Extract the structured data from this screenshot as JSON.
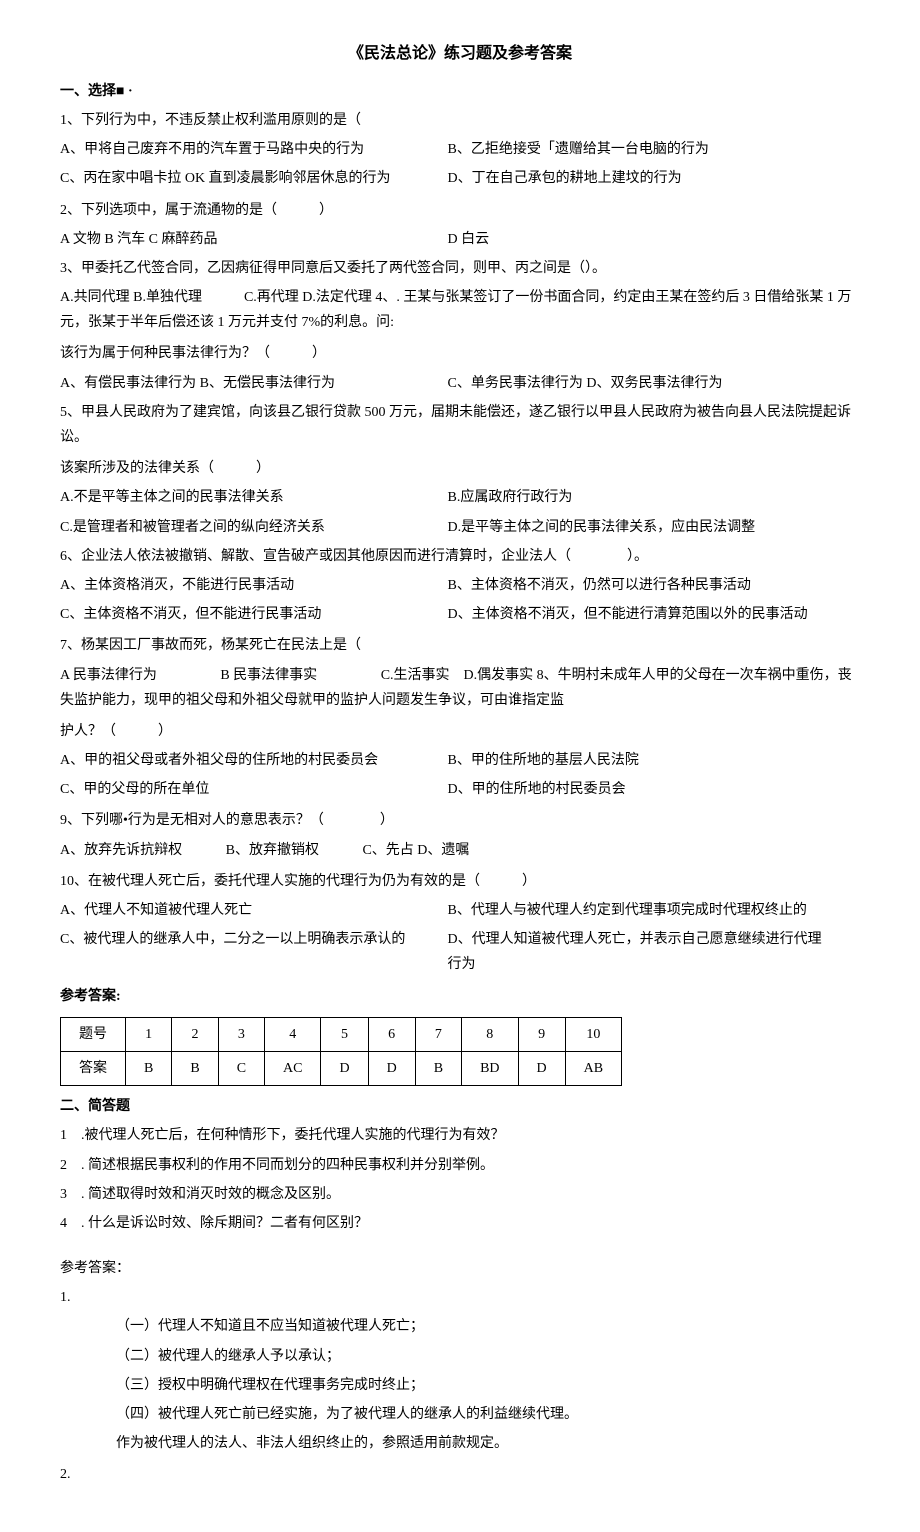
{
  "title": "《民法总论》练习题及参考答案",
  "sec1_head": "一、选择■ ·",
  "q1": {
    "stem": "1、下列行为中，不违反禁止权利滥用原则的是（",
    "a": "A、甲将自己废弃不用的汽车置于马路中央的行为",
    "b": "B、乙拒绝接受「遗赠给其一台电脑的行为",
    "c": "C、丙在家中唱卡拉 OK 直到凌晨影响邻居休息的行为",
    "d": "D、丁在自己承包的耕地上建坟的行为"
  },
  "q2": {
    "stem": "2、下列选项中，属于流通物的是（　　　）",
    "a": "A 文物 B 汽车 C 麻醉药品",
    "d": "D 白云"
  },
  "q3": {
    "stem": "3、甲委托乙代签合同，乙因病征得甲同意后又委托了两代签合同，则甲、丙之间是（）。",
    "line": "A.共同代理 B.单独代理　　　C.再代理 D.法定代理 4、. 王某与张某签订了一份书面合同，约定由王某在签约后 3 日借给张某 1 万元，张某于半年后偿还该 1 万元并支付 7%的利息。问:"
  },
  "q4": {
    "stem": "该行为属于何种民事法律行为？（　　　）",
    "a": "A、有偿民事法律行为 B、无偿民事法律行为",
    "c": "C、单务民事法律行为 D、双务民事法律行为"
  },
  "q5": {
    "stem": "5、甲县人民政府为了建宾馆，向该县乙银行贷款 500 万元，届期未能偿还，遂乙银行以甲县人民政府为被告向县人民法院提起诉讼。",
    "stem2": "该案所涉及的法律关系（　　　）",
    "a": "A.不是平等主体之间的民事法律关系",
    "b": "B.应属政府行政行为",
    "c": "C.是管理者和被管理者之间的纵向经济关系",
    "d": "D.是平等主体之间的民事法律关系，应由民法调整"
  },
  "q6": {
    "stem": "6、企业法人依法被撤销、解散、宣告破产或因其他原因而进行清算时，企业法人（　　　　）。",
    "a": "A、主体资格消灭，不能进行民事活动",
    "b": "B、主体资格不消灭，仍然可以进行各种民事活动",
    "c": "C、主体资格不消灭，但不能进行民事活动",
    "d": "D、主体资格不消灭，但不能进行清算范围以外的民事活动"
  },
  "q7": {
    "stem": "7、杨某因工厂事故而死，杨某死亡在民法上是（",
    "a": "A 民事法律行为",
    "b": "B 民事法律事实",
    "cd": "C.生活事实　D.偶发事实 8、牛明村未成年人甲的父母在一次车祸中重伤，丧失监护能力，现甲的祖父母和外祖父母就甲的监护人问题发生争议，可由谁指定监"
  },
  "q8": {
    "stem": "护人？（　　　）",
    "a": "A、甲的祖父母或者外祖父母的住所地的村民委员会",
    "b": "B、甲的住所地的基层人民法院",
    "c": "C、甲的父母的所在单位",
    "d": "D、甲的住所地的村民委员会"
  },
  "q9": {
    "stem": "9、下列哪•行为是无相对人的意思表示？（　　　　）",
    "a": "A、放弃先诉抗辩权",
    "b": "B、放弃撤销权",
    "c": "C、先占 D、遗嘱"
  },
  "q10": {
    "stem": "10、在被代理人死亡后，委托代理人实施的代理行为仍为有效的是（　　　）",
    "a": "A、代理人不知道被代理人死亡",
    "b": "B、代理人与被代理人约定到代理事项完成时代理权终止的",
    "c": "C、被代理人的继承人中，二分之一以上明确表示承认的",
    "d": "D、代理人知道被代理人死亡，并表示自己愿意继续进行代理行为"
  },
  "ans_label": "参考答案:",
  "table": {
    "h": [
      "题号",
      "1",
      "2",
      "3",
      "4",
      "5",
      "6",
      "7",
      "8",
      "9",
      "10"
    ],
    "r": [
      "答案",
      "B",
      "B",
      "C",
      "AC",
      "D",
      "D",
      "B",
      "BD",
      "D",
      "AB"
    ]
  },
  "sec2_head": "二、简答题",
  "sa": {
    "1": "1　.被代理人死亡后，在何种情形下，委托代理人实施的代理行为有效？",
    "2": "2　. 简述根据民事权利的作用不同而划分的四种民事权利并分别举例。",
    "3": "3　. 简述取得时效和消灭时效的概念及区别。",
    "4": "4　. 什么是诉讼时效、除斥期间？二者有何区别？"
  },
  "ans2_label": "参考答案：",
  "a1": {
    "n": "1.",
    "l1": "（一）代理人不知道且不应当知道被代理人死亡；",
    "l2": "（二）被代理人的继承人予以承认；",
    "l3": "（三）授权中明确代理权在代理事务完成时终止；",
    "l4": "（四）被代理人死亡前已经实施，为了被代理人的继承人的利益继续代理。",
    "l5": "作为被代理人的法人、非法人组织终止的，参照适用前款规定。"
  },
  "a2n": "2."
}
